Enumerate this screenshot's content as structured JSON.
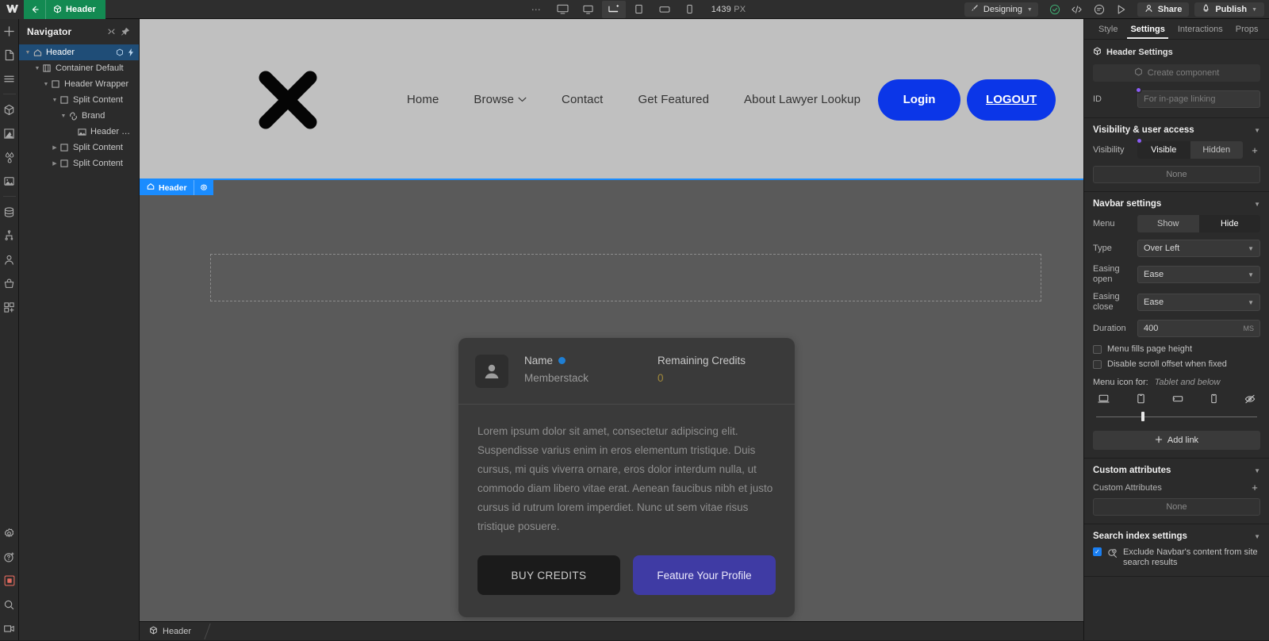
{
  "topbar": {
    "logo": "webflow-logo",
    "back_label": "Header",
    "dots": "⋯",
    "breakpoints": [
      {
        "name": "desktop-large",
        "active": false
      },
      {
        "name": "desktop",
        "active": false
      },
      {
        "name": "desktop-base",
        "active": true
      },
      {
        "name": "tablet",
        "active": false
      },
      {
        "name": "mobile-landscape",
        "active": false
      },
      {
        "name": "mobile-portrait",
        "active": false
      }
    ],
    "viewport_value": "1439",
    "viewport_unit": "PX",
    "mode_label": "Designing",
    "share_label": "Share",
    "publish_label": "Publish"
  },
  "navigator": {
    "title": "Navigator",
    "tree": [
      {
        "label": "Header",
        "depth": 0,
        "arrow": "down",
        "icon": "home",
        "selected": true
      },
      {
        "label": "Container Default",
        "depth": 1,
        "arrow": "down",
        "icon": "container",
        "selected": false
      },
      {
        "label": "Header Wrapper",
        "depth": 2,
        "arrow": "down",
        "icon": "div",
        "selected": false
      },
      {
        "label": "Split Content",
        "depth": 3,
        "arrow": "down",
        "icon": "div",
        "selected": false
      },
      {
        "label": "Brand",
        "depth": 4,
        "arrow": "down",
        "icon": "link",
        "selected": false
      },
      {
        "label": "Header Logo",
        "depth": 5,
        "arrow": "none",
        "icon": "image",
        "selected": false
      },
      {
        "label": "Split Content",
        "depth": 3,
        "arrow": "right",
        "icon": "div",
        "selected": false
      },
      {
        "label": "Split Content",
        "depth": 3,
        "arrow": "right",
        "icon": "div",
        "selected": false
      }
    ]
  },
  "rail": {
    "top_icons": [
      "add-panel-icon",
      "pages-icon",
      "navigator-icon",
      "components-icon",
      "assets-icon",
      "variables-icon",
      "media-icon",
      "cms-icon",
      "logic-icon",
      "users-icon",
      "ecommerce-icon",
      "apps-icon"
    ],
    "bottom_icons": [
      "settings-icon",
      "help-icon",
      "recording-icon",
      "search-icon",
      "video-icon"
    ]
  },
  "canvas": {
    "site_header": {
      "logo_name": "x-brand-logo",
      "nav_links": [
        {
          "label": "Home",
          "has_caret": false
        },
        {
          "label": "Browse",
          "has_caret": true
        },
        {
          "label": "Contact",
          "has_caret": false
        },
        {
          "label": "Get Featured",
          "has_caret": false
        },
        {
          "label": "About Lawyer Lookup",
          "has_caret": false
        }
      ],
      "login_label": "Login",
      "logout_label": "LOGOUT"
    },
    "selection_badge": {
      "label": "Header",
      "icon": "home-icon",
      "settings_icon": "gear-icon"
    },
    "member_card": {
      "avatar": "user-avatar-icon",
      "name_label": "Name",
      "name_value": "Memberstack",
      "verified": true,
      "credits_label": "Remaining Credits",
      "credits_value": "0",
      "paragraph": "Lorem ipsum dolor sit amet, consectetur adipiscing elit. Suspendisse varius enim in eros elementum tristique. Duis cursus, mi quis viverra ornare, eros dolor interdum nulla, ut commodo diam libero vitae erat. Aenean faucibus nibh et justo cursus id rutrum lorem imperdiet. Nunc ut sem vitae risus tristique posuere.",
      "buy_credits_label": "BUY CREDITS",
      "feature_profile_label": "Feature Your Profile"
    }
  },
  "statusbar": {
    "crumb_label": "Header",
    "crumb_icon": "component-icon"
  },
  "rightpanel": {
    "tabs": [
      {
        "label": "Style",
        "active": false
      },
      {
        "label": "Settings",
        "active": true
      },
      {
        "label": "Interactions",
        "active": false
      },
      {
        "label": "Props",
        "active": false
      }
    ],
    "element_title": "Header Settings",
    "create_component_label": "Create component",
    "id_label": "ID",
    "id_placeholder": "For in-page linking",
    "visibility_section": {
      "title": "Visibility & user access",
      "label": "Visibility",
      "options": [
        {
          "label": "Visible",
          "selected": true
        },
        {
          "label": "Hidden",
          "selected": false
        }
      ],
      "none_label": "None"
    },
    "navbar_section": {
      "title": "Navbar settings",
      "menu_label": "Menu",
      "menu_options": [
        {
          "label": "Show",
          "selected": false
        },
        {
          "label": "Hide",
          "selected": true
        }
      ],
      "type_label": "Type",
      "type_value": "Over Left",
      "easing_open_label": "Easing open",
      "easing_open_value": "Ease",
      "easing_close_label": "Easing close",
      "easing_close_value": "Ease",
      "duration_label": "Duration",
      "duration_value": "400",
      "duration_unit": "MS",
      "checkboxes": [
        {
          "label": "Menu fills page height",
          "checked": false
        },
        {
          "label": "Disable scroll offset when fixed",
          "checked": false
        }
      ],
      "menu_icon_for_label": "Menu icon for:",
      "menu_icon_for_value": "Tablet and below",
      "breakpoint_icons": [
        "laptop-icon",
        "tablet-portrait-icon",
        "tablet-landscape-icon",
        "mobile-icon",
        "hidden-eye-icon"
      ],
      "add_link_label": "Add link"
    },
    "custom_attributes_section": {
      "title": "Custom attributes",
      "row_label": "Custom Attributes",
      "none_label": "None"
    },
    "search_index_section": {
      "title": "Search index settings",
      "checkbox_label": "Exclude Navbar's content from site search results",
      "checked": true
    }
  },
  "colors": {
    "accent_blue": "#1a7ef0",
    "brand_blue": "#0b36e8",
    "green": "#138a52",
    "purple": "#3f3ba4",
    "panel_bg": "#2b2b2b",
    "canvas_bg": "#5a5a5a",
    "header_bg": "#c0c0c0"
  }
}
